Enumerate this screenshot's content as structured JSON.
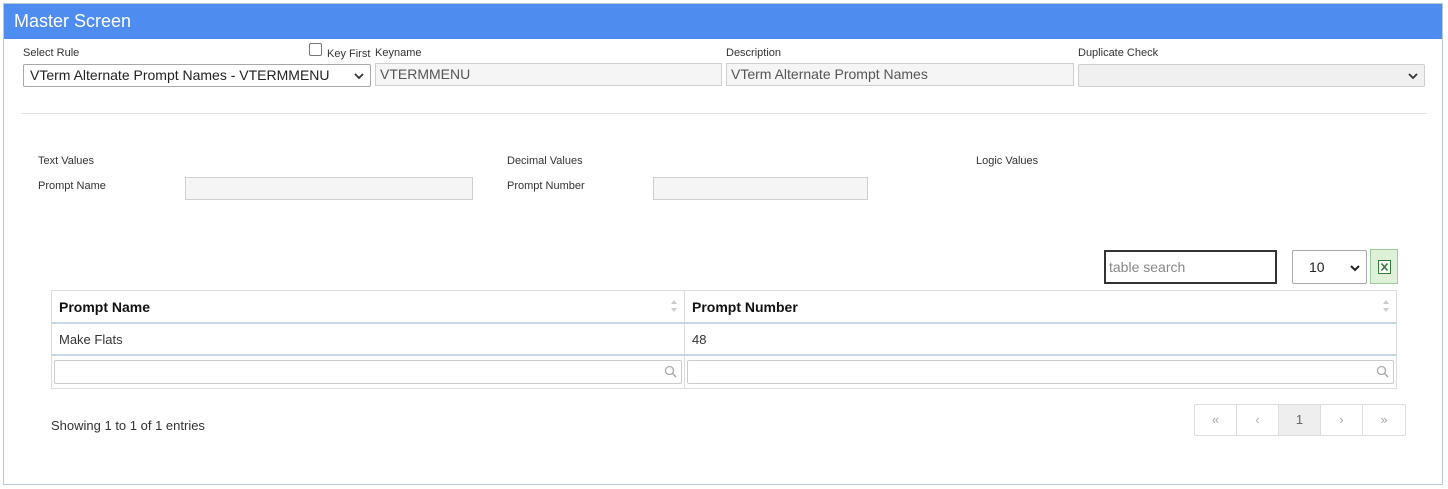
{
  "header": {
    "title": "Master Screen"
  },
  "rule": {
    "select_rule_label": "Select Rule",
    "select_rule_value": "VTerm Alternate Prompt Names - VTERMMENU",
    "key_first_label": "Key First",
    "keyname_label": "Keyname",
    "keyname_value": "VTERMMENU",
    "description_label": "Description",
    "description_value": "VTerm Alternate Prompt Names",
    "duplicate_check_label": "Duplicate Check",
    "duplicate_check_value": ""
  },
  "values": {
    "text_values_label": "Text Values",
    "prompt_name_label": "Prompt Name",
    "prompt_name_value": "",
    "decimal_values_label": "Decimal Values",
    "prompt_number_label": "Prompt Number",
    "prompt_number_value": "",
    "logic_values_label": "Logic Values"
  },
  "table": {
    "search_placeholder": "table search",
    "page_size": "10",
    "columns": [
      "Prompt Name",
      "Prompt Number"
    ],
    "rows": [
      [
        "Make Flats",
        "48"
      ]
    ],
    "info": "Showing 1 to 1 of 1 entries",
    "pager": [
      "«",
      "‹",
      "1",
      "›",
      "»"
    ]
  }
}
